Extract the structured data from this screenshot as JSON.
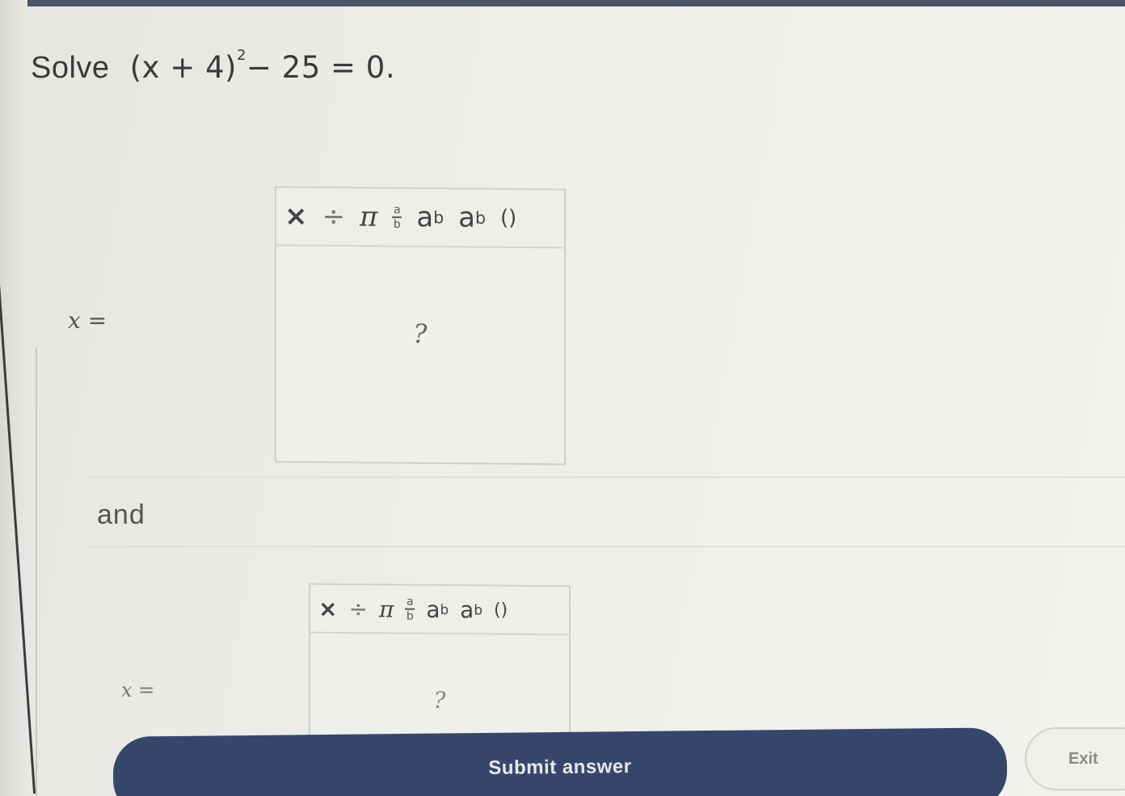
{
  "problem": {
    "label": "Solve",
    "expression_left": "(x + 4)",
    "exponent": "2",
    "expression_right": "− 25 = 0."
  },
  "answer1": {
    "variable_label": "x =",
    "toolbar": {
      "times": "×",
      "divide": "÷",
      "pi": "π",
      "fraction_top": "a",
      "fraction_bottom": "b",
      "power_base": "a",
      "power_exp": "b",
      "sub_base": "a",
      "sub_index": "b",
      "parens": "()"
    },
    "placeholder": "?"
  },
  "connector": "and",
  "answer2": {
    "variable_label": "x =",
    "toolbar": {
      "times": "×",
      "divide": "÷",
      "pi": "π",
      "fraction_top": "a",
      "fraction_bottom": "b",
      "power_base": "a",
      "power_exp": "b",
      "sub_base": "a",
      "sub_index": "b",
      "parens": "()"
    },
    "placeholder": "?"
  },
  "buttons": {
    "submit": "Submit answer",
    "exit": "Exit"
  },
  "colors": {
    "submit_bg": "#36466b",
    "top_bar": "#4b5468"
  }
}
